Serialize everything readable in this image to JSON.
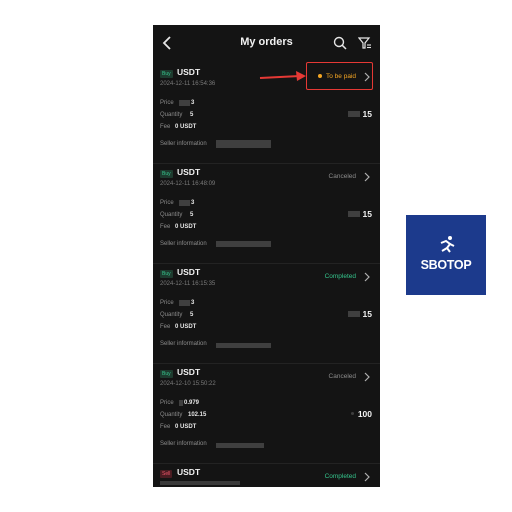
{
  "header": {
    "title": "My orders"
  },
  "orders": [
    {
      "type": "Buy",
      "asset": "USDT",
      "timestamp": "2024-12-11 16:54:36",
      "status": "To be paid",
      "price_label": "Price",
      "price": "3",
      "quantity_label": "Quantity",
      "quantity": "5",
      "fee_label": "Fee",
      "fee": "0 USDT",
      "amount": "15",
      "seller_label": "Seller information"
    },
    {
      "type": "Buy",
      "asset": "USDT",
      "timestamp": "2024-12-11 16:48:09",
      "status": "Canceled",
      "price_label": "Price",
      "price": "3",
      "quantity_label": "Quantity",
      "quantity": "5",
      "fee_label": "Fee",
      "fee": "0 USDT",
      "amount": "15",
      "seller_label": "Seller information"
    },
    {
      "type": "Buy",
      "asset": "USDT",
      "timestamp": "2024-12-11 16:15:35",
      "status": "Completed",
      "price_label": "Price",
      "price": "3",
      "quantity_label": "Quantity",
      "quantity": "5",
      "fee_label": "Fee",
      "fee": "0 USDT",
      "amount": "15",
      "seller_label": "Seller information"
    },
    {
      "type": "Buy",
      "asset": "USDT",
      "timestamp": "2024-12-10 15:50:22",
      "status": "Canceled",
      "price_label": "Price",
      "price": "0.979",
      "quantity_label": "Quantity",
      "quantity": "102.15",
      "fee_label": "Fee",
      "fee": "0 USDT",
      "amount": "100",
      "seller_label": "Seller information"
    },
    {
      "type": "Sell",
      "asset": "USDT",
      "status": "Completed"
    }
  ],
  "watermark": {
    "brand": "SBOTOP"
  },
  "colors": {
    "background": "#141414",
    "pending": "#f5a623",
    "completed": "#35c48c",
    "canceled": "#8c8c8c",
    "annotation": "#e53935",
    "brand": "#1c3a8c"
  }
}
